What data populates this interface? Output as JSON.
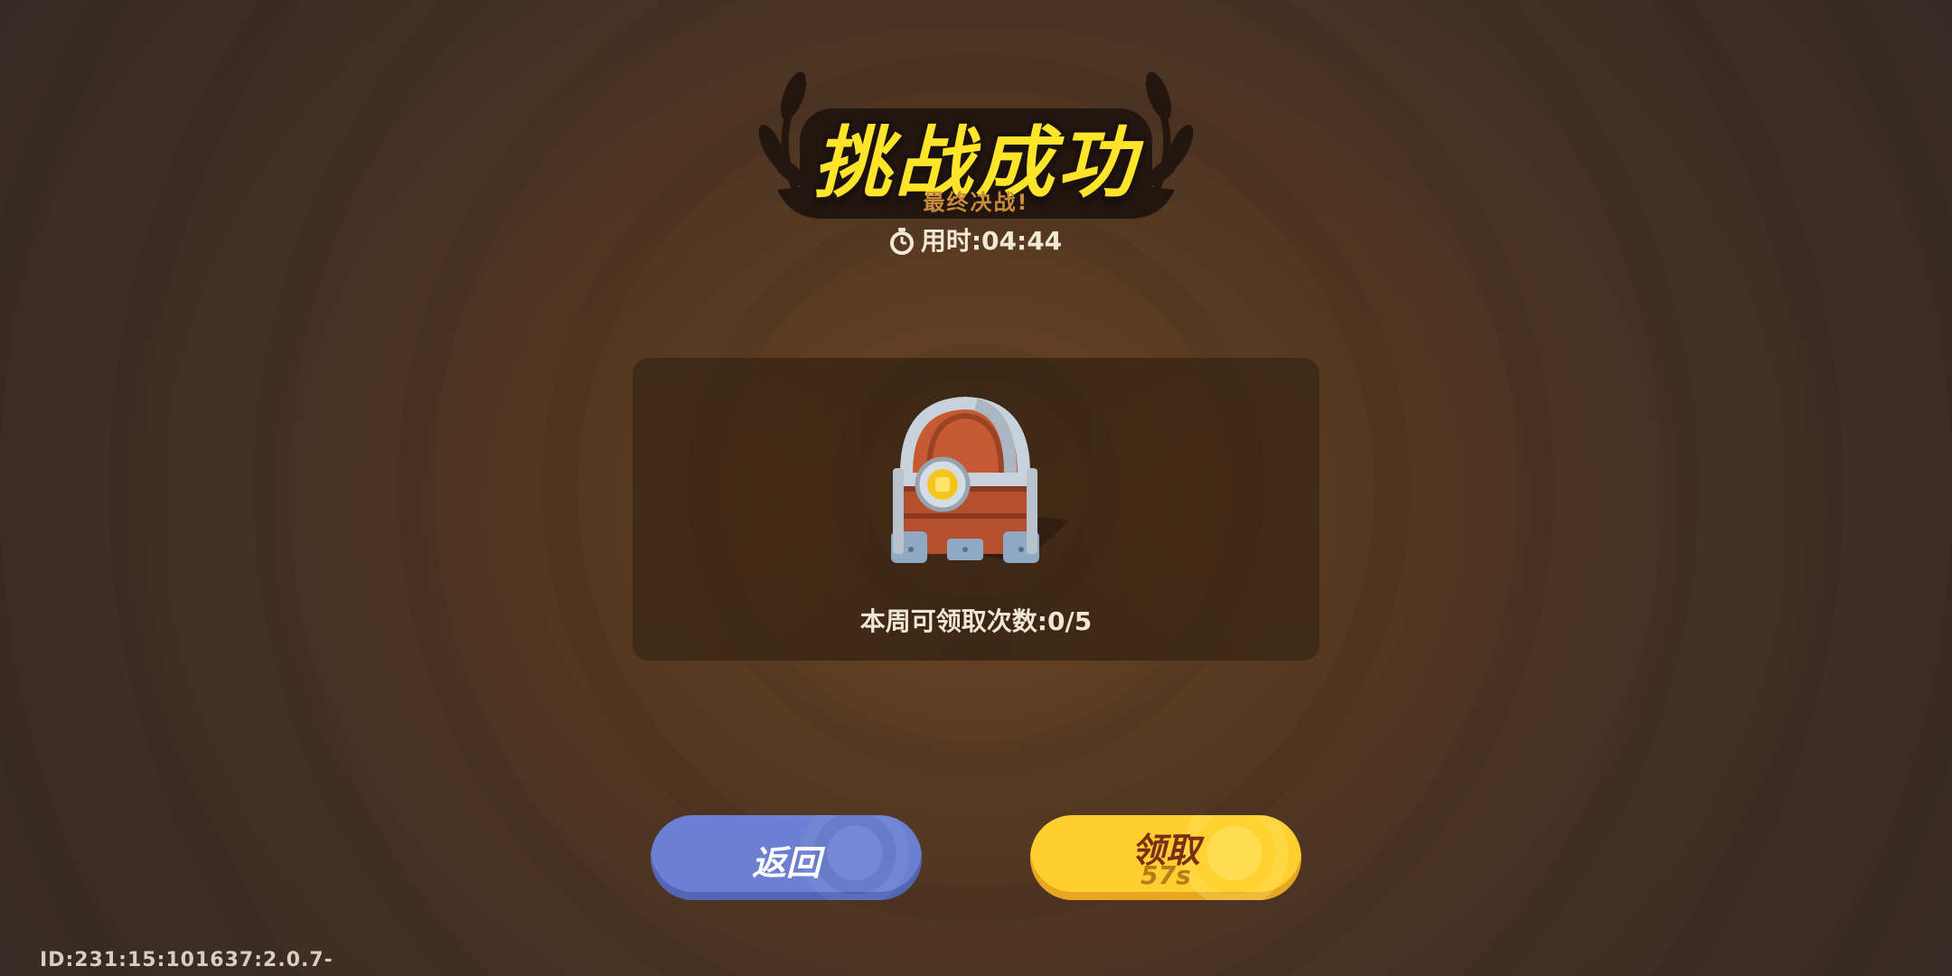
{
  "header": {
    "title": "挑战成功",
    "subtitle": "最终决战!",
    "timer_label": "用时:04:44"
  },
  "reward_panel": {
    "item_icon": "treasure-chest",
    "claims_text": "本周可领取次数:0/5"
  },
  "buttons": {
    "back_label": "返回",
    "claim_label": "领取",
    "claim_countdown": "57s"
  },
  "footer": {
    "build_id": "ID:231:15:101637:2.0.7-"
  },
  "colors": {
    "title": "#ffe52a",
    "subtitle": "#c98a3e",
    "back_button": "#6c7fd2",
    "claim_button": "#ffce2f",
    "claim_text": "#7b2e14"
  }
}
